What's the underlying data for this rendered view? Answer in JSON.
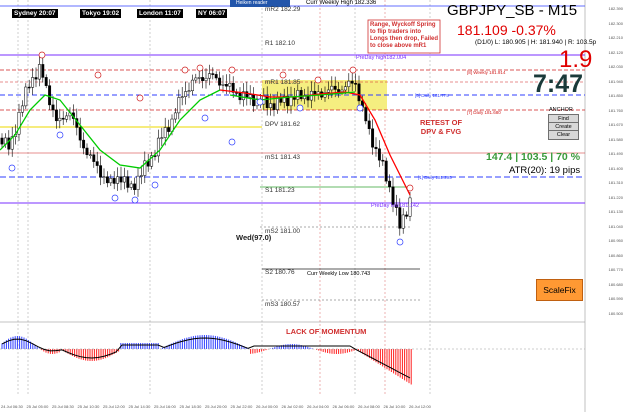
{
  "header": {
    "symbol_title": "GBPJPY_SB - M15",
    "price_change": "181.109 -0.37%",
    "ohlc_info": "(D1/0) L: 180.905 | H: 181.940 | R: 103.5p",
    "spread": "1.9",
    "countdown": "7:47",
    "stats": "147.4 | 103.5 | 70 %",
    "atr": "ATR(20): 19 pips"
  },
  "top_bar": {
    "label": "Heiken reader"
  },
  "sessions": {
    "sydney": "Sydney 20:07",
    "tokyo": "Tokyo 19:02",
    "london": "London 11:07",
    "ny": "NY 06:07"
  },
  "levels": {
    "mr2": "mR2 182.29",
    "r1": "R1 182.10",
    "mr1": "mR1 181.85",
    "dpv": "DPV 181.62",
    "ms1": "mS1 181.43",
    "s1": "S1 181.23",
    "ms2": "mS2 181.00",
    "s2": "S2 180.76",
    "ms3": "mS3 180.57",
    "curr_weekly_high": "Curr Weekly High 182.336",
    "curr_weekly_low": "Curr Weekly Low 180.743",
    "preday_high": "PreDay high182.004",
    "preday_low": "PreDay low181.142",
    "weekly_r": "[8] Weekly 181.914",
    "daily_1775": "[5] Daily 181.775",
    "daily_680": "[7] Daily 181.680",
    "daily_295": "[1] Daily 181.295",
    "wed": "Wed(97.0)"
  },
  "annotations": {
    "range_note": "Range, Wyckoff Spring to flip traders into Longs then drop, Failed to close above mR1",
    "retest": "RETEST OF DPV & FVG",
    "momentum": "LACK OF MOMENTUM"
  },
  "anchor": {
    "title": "ANCHOR",
    "find": "Find",
    "create": "Create",
    "clear": "Clear"
  },
  "scalefix": "ScaleFix",
  "price_axis": [
    "182.390",
    "182.300",
    "182.210",
    "182.120",
    "182.030",
    "181.940",
    "181.850",
    "181.760",
    "181.670",
    "181.580",
    "181.490",
    "181.400",
    "181.310",
    "181.220",
    "181.130",
    "181.040",
    "180.950",
    "180.860",
    "180.770",
    "180.680",
    "180.590",
    "180.500"
  ],
  "time_axis": [
    "24 Jul 06:30",
    "25 Jul 05:00",
    "25 Jul 08:30",
    "25 Jul 10:30",
    "25 Jul 12:00",
    "25 Jul 14:30",
    "25 Jul 16:00",
    "25 Jul 18:30",
    "25 Jul 20:00",
    "25 Jul 22:00",
    "26 Jul 00:00",
    "26 Jul 02:00",
    "26 Jul 04:00",
    "26 Jul 06:00",
    "26 Jul 08:00",
    "26 Jul 10:00",
    "26 Jul 12:00"
  ],
  "colors": {
    "title": "#000000",
    "change_red": "#e00000",
    "countdown": "#1a3a3a",
    "stats_green": "#3a9a3a",
    "annotation_red": "#d03030",
    "pivot_blue": "#2f3fff",
    "pivot_red": "#d02020",
    "sma_green": "#00cc00",
    "sma_red": "#ff0000",
    "range_fill": "#f5ee80"
  }
}
